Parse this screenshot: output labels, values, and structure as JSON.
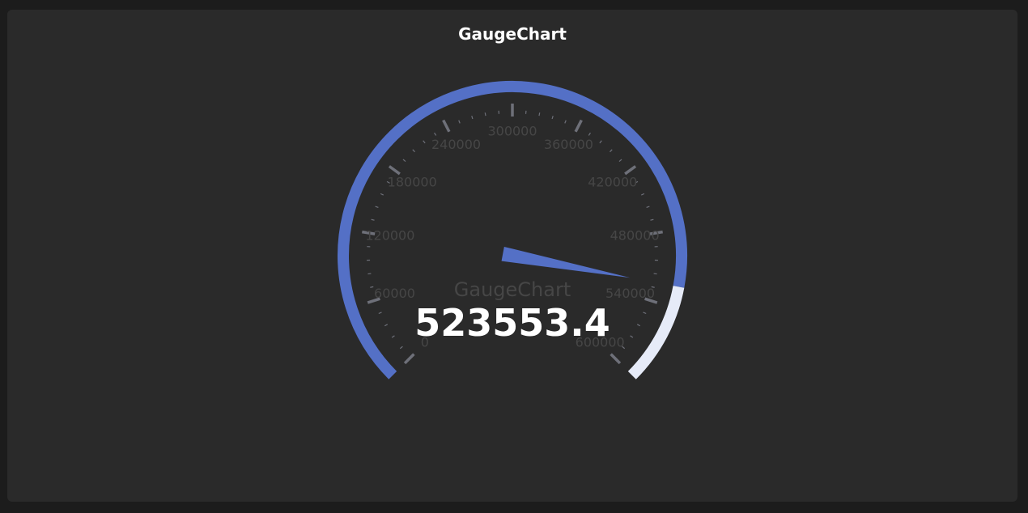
{
  "panel": {
    "title": "GaugeChart"
  },
  "chart_data": {
    "type": "gauge",
    "title": "GaugeChart",
    "series_name": "GaugeChart",
    "value": 523553.4,
    "value_label": "523553.4",
    "min": 0,
    "max": 600000,
    "tick_labels": [
      "0",
      "60000",
      "120000",
      "180000",
      "240000",
      "300000",
      "360000",
      "420000",
      "480000",
      "540000",
      "600000"
    ],
    "colors": {
      "progress": "#5470c6",
      "remaining": "#e6ebf8",
      "ticks": "#6e7079",
      "tick_labels": "#464646",
      "pointer": "#5470c6",
      "value_text": "#ffffff",
      "series_name_text": "#464646"
    }
  }
}
